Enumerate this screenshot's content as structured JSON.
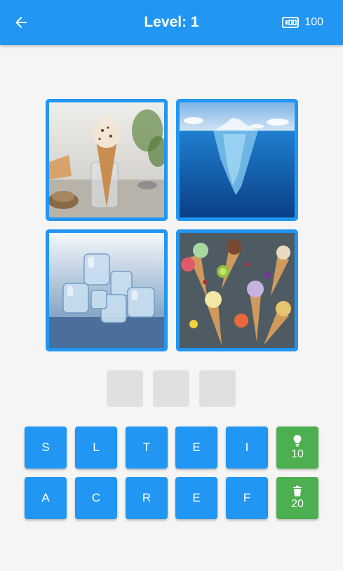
{
  "appbar": {
    "title": "Level: 1",
    "back_icon": "arrow-left-icon",
    "coins_icon": "coins-counter-icon",
    "coins": "100",
    "color": "#2196f3"
  },
  "images": [
    {
      "name": "ice-cream-cone-photo",
      "icon": "ice-cream-cone"
    },
    {
      "name": "iceberg-photo",
      "icon": "iceberg"
    },
    {
      "name": "ice-cubes-photo",
      "icon": "ice-cubes"
    },
    {
      "name": "ice-cream-cones-flatlay-photo",
      "icon": "ice-cream-cones"
    }
  ],
  "answer_slots": [
    "",
    "",
    ""
  ],
  "keyboard": {
    "row1": [
      "S",
      "L",
      "T",
      "E",
      "I"
    ],
    "row2": [
      "A",
      "C",
      "R",
      "E",
      "F"
    ]
  },
  "hints": {
    "reveal": {
      "icon": "lightbulb-icon",
      "cost": "10"
    },
    "remove": {
      "icon": "trash-icon",
      "cost": "20"
    }
  },
  "colors": {
    "accent": "#2196f3",
    "hint": "#4caf50",
    "slot": "#e0e0e0"
  }
}
